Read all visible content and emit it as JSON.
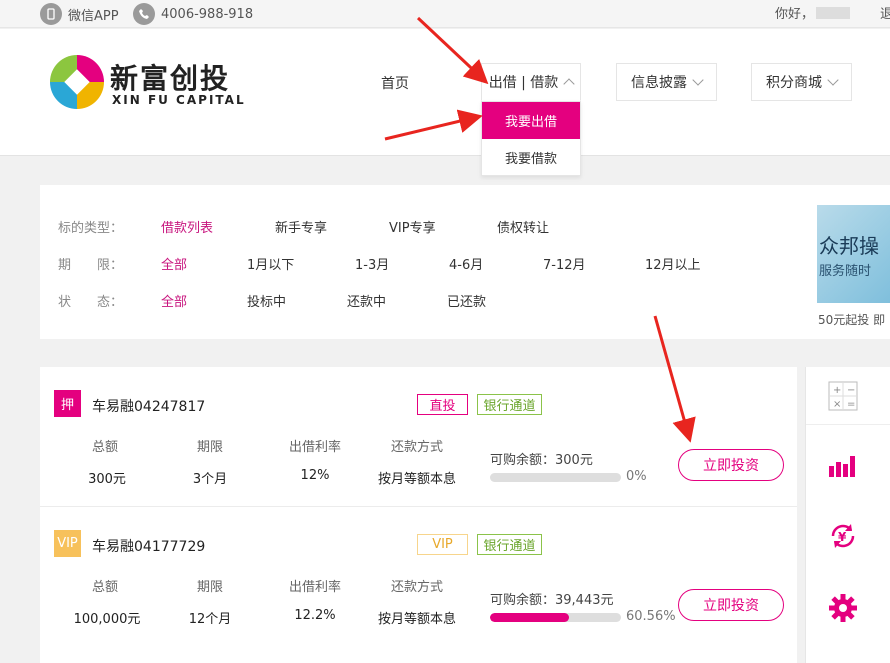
{
  "topbar": {
    "app_label": "微信APP",
    "phone": "4006-988-918",
    "greeting": "你好，",
    "logout_partial": "退"
  },
  "logo": {
    "cn": "新富创投",
    "en": "XIN FU CAPITAL"
  },
  "nav": {
    "home": "首页",
    "lend_borrow": "出借 | 借款",
    "disclosure": "信息披露",
    "points_mall": "积分商城",
    "dropdown": [
      "我要出借",
      "我要借款"
    ]
  },
  "filters": {
    "type_label": "标的类型：",
    "type_options": [
      "借款列表",
      "新手专享",
      "VIP专享",
      "债权转让"
    ],
    "term_label": "期　　限：",
    "term_options": [
      "全部",
      "1月以下",
      "1-3月",
      "4-6月",
      "7-12月",
      "12月以上"
    ],
    "status_label": "状　　态：",
    "status_options": [
      "全部",
      "投标中",
      "还款中",
      "已还款"
    ]
  },
  "banner": {
    "title": "众邦操",
    "subtitle": "服务随时",
    "footer": "50元起投 即"
  },
  "columns": {
    "total": "总额",
    "term": "期限",
    "rate": "出借利率",
    "repay": "还款方式"
  },
  "loans": [
    {
      "badge": "押",
      "badge_color": "#e4007f",
      "title": "车易融04247817",
      "tag1": "直投",
      "tag2": "银行通道",
      "total": "300元",
      "term": "3个月",
      "rate": "12%",
      "repay": "按月等额本息",
      "remain": "可购余额：300元",
      "progress": 0,
      "pct": "0%",
      "button": "立即投资"
    },
    {
      "badge": "VIP",
      "badge_color": "#f7c15b",
      "title": "车易融04177729",
      "tag1": "VIP",
      "tag2": "银行通道",
      "total": "100,000元",
      "term": "12个月",
      "rate": "12.2%",
      "repay": "按月等额本息",
      "remain": "可购余额：39,443元",
      "progress": 60.56,
      "pct": "60.56%",
      "button": "立即投资"
    }
  ],
  "sidebar": [
    "calculator-icon",
    "chart-bars-icon",
    "yuan-refresh-icon",
    "gear-icon"
  ],
  "colors": {
    "accent": "#e4007f",
    "bank_tag": "#8bc34a",
    "vip_tag": "#f7c15b",
    "annotation": "#e8251f"
  }
}
